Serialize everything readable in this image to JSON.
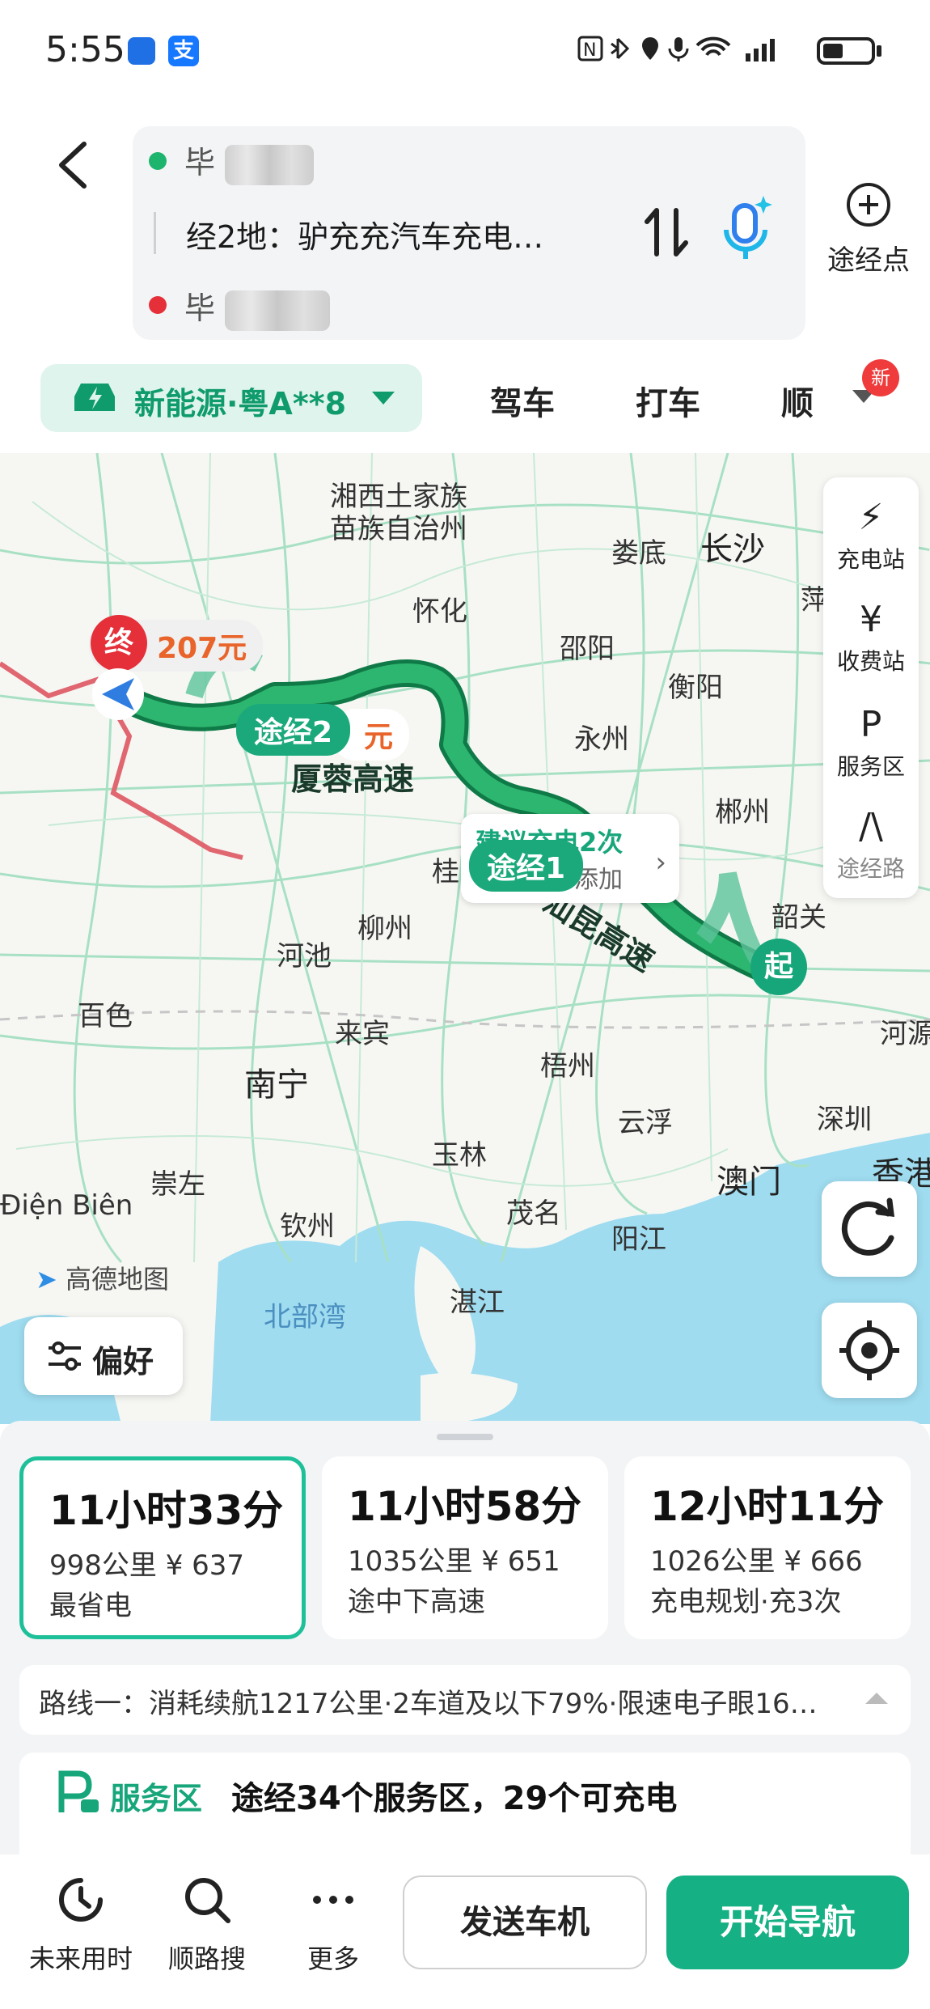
{
  "status_bar": {
    "time": "5:55",
    "app_badge": "支",
    "indicators": "N ✱ ⬤ ⬤ ≋ ıll"
  },
  "header": {
    "origin_prefix": "毕",
    "waypoints_text": "经2地：驴充充汽车充电…",
    "destination_prefix": "毕",
    "add_waypoint_label": "途经点"
  },
  "modes": {
    "vehicle_label": "新能源·粤A**8",
    "tabs": [
      "驾车",
      "打车",
      "顺"
    ],
    "new_badge": "新"
  },
  "map": {
    "cities": [
      {
        "name": "湘西土家族",
        "big": false
      },
      {
        "name": "苗族自治州",
        "big": false
      },
      {
        "name": "娄底",
        "big": false
      },
      {
        "name": "长沙",
        "big": true
      },
      {
        "name": "怀化",
        "big": false
      },
      {
        "name": "邵阳",
        "big": false
      },
      {
        "name": "衡阳",
        "big": false
      },
      {
        "name": "永州",
        "big": false
      },
      {
        "name": "郴州",
        "big": false
      },
      {
        "name": "韶关",
        "big": false
      },
      {
        "name": "桂",
        "big": false
      },
      {
        "name": "柳州",
        "big": false
      },
      {
        "name": "河池",
        "big": false
      },
      {
        "name": "百色",
        "big": false
      },
      {
        "name": "来宾",
        "big": false
      },
      {
        "name": "南宁",
        "big": true
      },
      {
        "name": "梧州",
        "big": false
      },
      {
        "name": "河源",
        "big": false
      },
      {
        "name": "云浮",
        "big": false
      },
      {
        "name": "深圳",
        "big": false
      },
      {
        "name": "玉林",
        "big": false
      },
      {
        "name": "崇左",
        "big": false
      },
      {
        "name": "澳门",
        "big": true
      },
      {
        "name": "香港",
        "big": true
      },
      {
        "name": "钦州",
        "big": false
      },
      {
        "name": "茂名",
        "big": false
      },
      {
        "name": "阳江",
        "big": false
      },
      {
        "name": "湛江",
        "big": false
      },
      {
        "name": "北部湾",
        "big": false
      },
      {
        "name": "Điện Biên",
        "big": false
      },
      {
        "name": "萍",
        "big": false
      }
    ],
    "road_labels": [
      "厦蓉高速",
      "汕昆高速"
    ],
    "markers": {
      "end": "终",
      "start": "起",
      "waypoint1": "途经1",
      "waypoint2": "途经2",
      "price_end": "207元",
      "price_wp2": "元",
      "charge_suggest": "建议充电2次",
      "charge_add": "添加"
    },
    "side_tools": [
      {
        "icon": "⚡",
        "label": "充电站"
      },
      {
        "icon": "¥",
        "label": "收费站"
      },
      {
        "icon": "P",
        "label": "服务区"
      },
      {
        "icon": "/\\",
        "label": "途经路"
      }
    ],
    "preference_label": "偏好",
    "watermark": "高德地图"
  },
  "routes": [
    {
      "time": "11小时33分",
      "detail": "998公里 ¥ 637",
      "tag": "最省电",
      "selected": true
    },
    {
      "time": "11小时58分",
      "detail": "1035公里 ¥ 651",
      "tag": "途中下高速",
      "selected": false
    },
    {
      "time": "12小时11分",
      "detail": "1026公里 ¥ 666",
      "tag": "充电规划·充3次",
      "selected": false
    }
  ],
  "route_info": "路线一：消耗续航1217公里·2车道及以下79%·限速电子眼16…",
  "service_area": {
    "label": "服务区",
    "text": "途经34个服务区，29个可充电"
  },
  "bottom_bar": {
    "tools": [
      "未来用时",
      "顺路搜",
      "更多"
    ],
    "send_label": "发送车机",
    "navigate_label": "开始导航"
  },
  "colors": {
    "accent": "#15b083",
    "route_green": "#1f9e5e",
    "end_red": "#e5303a"
  }
}
